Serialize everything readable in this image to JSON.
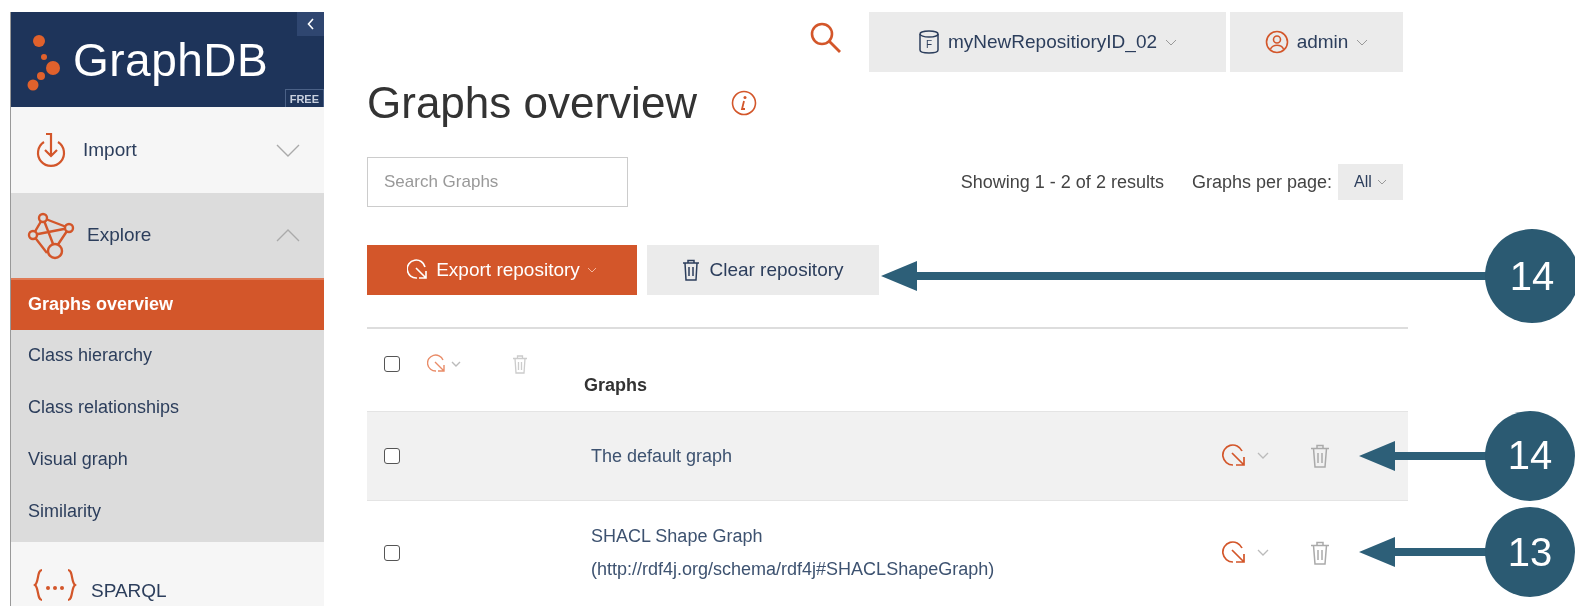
{
  "sidebar": {
    "logo": "GraphDB",
    "edition": "FREE",
    "groups": [
      {
        "label": "Import",
        "expanded": false
      },
      {
        "label": "Explore",
        "expanded": true,
        "children": [
          {
            "label": "Graphs overview",
            "selected": true
          },
          {
            "label": "Class hierarchy",
            "selected": false
          },
          {
            "label": "Class relationships",
            "selected": false
          },
          {
            "label": "Visual graph",
            "selected": false
          },
          {
            "label": "Similarity",
            "selected": false
          }
        ]
      },
      {
        "label": "SPARQL",
        "expanded": false
      }
    ]
  },
  "top_bar": {
    "repository": "myNewRepositioryID_02",
    "repository_badge": "F",
    "user": "admin"
  },
  "title": "Graphs overview",
  "search": {
    "placeholder": "Search Graphs"
  },
  "pagination": {
    "summary": "Showing 1 - 2 of 2 results",
    "per_page_label": "Graphs per page:",
    "per_page": "All"
  },
  "toolbar": {
    "export": "Export repository",
    "clear": "Clear repository",
    "callout": "14"
  },
  "table": {
    "column": "Graphs",
    "header_checked": false,
    "rows": [
      {
        "name": "The default graph",
        "uri": null,
        "checked": false,
        "hovered": true,
        "callout": "14"
      },
      {
        "name": "SHACL Shape Graph",
        "uri": "(http://rdf4j.org/schema/rdf4j#SHACLShapeGraph)",
        "checked": false,
        "hovered": false,
        "callout": "13"
      }
    ]
  }
}
